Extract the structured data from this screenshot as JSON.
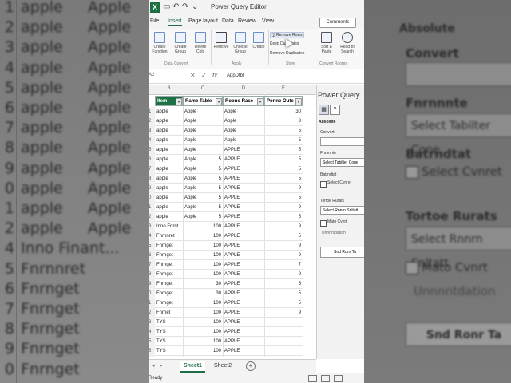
{
  "backdrop_left": {
    "rows": [
      {
        "n": "1",
        "t": "apple",
        "t2": "Apple"
      },
      {
        "n": "2",
        "t": "apple",
        "t2": "Apple"
      },
      {
        "n": "3",
        "t": "apple",
        "t2": "Apple"
      },
      {
        "n": "4",
        "t": "apple",
        "t2": "Apple"
      },
      {
        "n": "5",
        "t": "apple",
        "t2": "Apple"
      },
      {
        "n": "6",
        "t": "apple",
        "t2": "Apple"
      },
      {
        "n": "7",
        "t": "apple",
        "t2": "Apple"
      },
      {
        "n": "8",
        "t": "apple",
        "t2": "Apple"
      },
      {
        "n": "9",
        "t": "apple",
        "t2": "Apple"
      },
      {
        "n": "0",
        "t": "apple",
        "t2": "Apple"
      },
      {
        "n": "1",
        "t": "apple",
        "t2": "Apple"
      },
      {
        "n": "2",
        "t": "apple",
        "t2": "Apple"
      },
      {
        "n": "4",
        "t": "Inno Finant...",
        "t2": ""
      },
      {
        "n": "5",
        "t": "Fnrnnret",
        "t2": ""
      },
      {
        "n": "6",
        "t": "Fnrnget",
        "t2": ""
      },
      {
        "n": "7",
        "t": "Fnrnget",
        "t2": ""
      },
      {
        "n": "8",
        "t": "Fnrnget",
        "t2": ""
      },
      {
        "n": "9",
        "t": "Fnrnget",
        "t2": ""
      },
      {
        "n": "0",
        "t": "Fnrnget",
        "t2": ""
      }
    ]
  },
  "backdrop_right": {
    "section": "Absolute",
    "label1": "Convert",
    "label2": "Fnrnnnte",
    "box2": "Select Tabilter Cone",
    "label3": "Batrndtat",
    "chk1": "Select Cvnret",
    "label4": "Tortoe Rurats",
    "box4": "Select Rnnrn Snltatt",
    "chk2": "Mato Cvnrt",
    "label5": "Unnnntdation",
    "button": "Snd Ronr Ta"
  },
  "excel": {
    "titlebar": {
      "title": "Power Query Editor",
      "undo": "↶",
      "redo": "↷",
      "more": "⌄"
    },
    "menu": [
      "File",
      "Insert",
      "Page layout",
      "Data",
      "Review",
      "View"
    ],
    "active_menu": 1,
    "comments": "Comments",
    "ribbon": {
      "b1": "Create Function",
      "b2": "Create Group",
      "b3": "Delete Cols",
      "b4": "Remove",
      "b5": "Choose Group",
      "b6": "Create",
      "s1": "∑ Remove Rows",
      "s2": "Keep Duplicates",
      "s3": "Remove Duplicates",
      "b7": "Sort & Paste",
      "b8": "Read to Search",
      "g1": "Data Convert",
      "g2": "Apply",
      "g3": "Store",
      "g4": "Convert Rooms"
    },
    "formula": {
      "namebox": "A2",
      "cancel": "✕",
      "enter": "✓",
      "fx": "fx",
      "value": "AppDtbl"
    },
    "columns": [
      "B",
      "C",
      "D",
      "E"
    ],
    "headers": [
      "Item",
      "Rame Table",
      "Roono Rase",
      "Ponne Oute"
    ],
    "rows": [
      {
        "n": "1",
        "b": "apple",
        "c": "Apple",
        "cn": "",
        "d": "Apple",
        "e": "30"
      },
      {
        "n": "2",
        "b": "apple",
        "c": "Apple",
        "cn": "",
        "d": "Apple",
        "e": "3"
      },
      {
        "n": "3",
        "b": "apple",
        "c": "Apple",
        "cn": "",
        "d": "Apple",
        "e": "5"
      },
      {
        "n": "4",
        "b": "apple",
        "c": "Apple",
        "cn": "",
        "d": "Apple",
        "e": "5"
      },
      {
        "n": "5",
        "b": "apple",
        "c": "Apple",
        "cn": "",
        "d": "APPLE",
        "e": "5"
      },
      {
        "n": "6",
        "b": "apple",
        "c": "Apple",
        "cn": "5",
        "d": "APPLE",
        "e": "5"
      },
      {
        "n": "7",
        "b": "apple",
        "c": "Apple",
        "cn": "5",
        "d": "APPLE",
        "e": "5"
      },
      {
        "n": "8",
        "b": "apple",
        "c": "Apple",
        "cn": "5",
        "d": "APPLE",
        "e": "5"
      },
      {
        "n": "9",
        "b": "apple",
        "c": "Apple",
        "cn": "5",
        "d": "APPLE",
        "e": "9"
      },
      {
        "n": "0",
        "b": "apple",
        "c": "Apple",
        "cn": "5",
        "d": "APPLE",
        "e": "5"
      },
      {
        "n": "1",
        "b": "apple",
        "c": "Apple",
        "cn": "5",
        "d": "APPLE",
        "e": "9"
      },
      {
        "n": "2",
        "b": "apple",
        "c": "Apple",
        "cn": "5",
        "d": "APPLE",
        "e": "5"
      },
      {
        "n": "3",
        "b": "Inno Fnrnt...",
        "c": "",
        "cn": "100",
        "d": "APPLE",
        "e": "9"
      },
      {
        "n": "4",
        "b": "Fnrnnret",
        "c": "",
        "cn": "100",
        "d": "APPLE",
        "e": "5"
      },
      {
        "n": "5",
        "b": "Fnrnget",
        "c": "",
        "cn": "100",
        "d": "APPLE",
        "e": "9"
      },
      {
        "n": "6",
        "b": "Fnrnget",
        "c": "",
        "cn": "100",
        "d": "APPLE",
        "e": "9"
      },
      {
        "n": "7",
        "b": "Fnrnget",
        "c": "",
        "cn": "100",
        "d": "APPLE",
        "e": "7"
      },
      {
        "n": "8",
        "b": "Fnrnget",
        "c": "",
        "cn": "100",
        "d": "APPLE",
        "e": "9"
      },
      {
        "n": "9",
        "b": "Fnrnget",
        "c": "",
        "cn": "30",
        "d": "APPLE",
        "e": "5"
      },
      {
        "n": "0",
        "b": "Fnrnget",
        "c": "",
        "cn": "30",
        "d": "APPLE",
        "e": "5"
      },
      {
        "n": "1",
        "b": "Fnrnget",
        "c": "",
        "cn": "100",
        "d": "APPLE",
        "e": "5"
      },
      {
        "n": "2",
        "b": "Fnrnet",
        "c": "",
        "cn": "100",
        "d": "APPLE",
        "e": "9"
      },
      {
        "n": "3",
        "b": "TYS",
        "c": "",
        "cn": "100",
        "d": "APPLE",
        "e": ""
      },
      {
        "n": "4",
        "b": "TYS",
        "c": "",
        "cn": "100",
        "d": "APPLE",
        "e": ""
      },
      {
        "n": "5",
        "b": "TYS",
        "c": "",
        "cn": "100",
        "d": "APPLE",
        "e": ""
      },
      {
        "n": "6",
        "b": "TYS",
        "c": "",
        "cn": "100",
        "d": "APPLE",
        "e": ""
      },
      {
        "n": "7",
        "b": "TYS",
        "c": "",
        "cn": "100",
        "d": "APPLE",
        "e": ""
      }
    ],
    "tabs": [
      "Sheet1",
      "Sheet2"
    ],
    "status": "Ready",
    "pq": {
      "title": "Power Query",
      "section": "Absolute",
      "convert": "Convert",
      "fnr": "Fnrnnnte",
      "box1": "Select Tabilter Cone",
      "batr": "Batrndtat",
      "chk1": "Select Cvnret",
      "tortoe": "Tortoe Rurats",
      "box2": "Select Rnnrn Snltatt",
      "chk2": "Mato Cvnrt",
      "unn": "Unnnntdation",
      "button": "Snd Ronr Ta"
    }
  }
}
